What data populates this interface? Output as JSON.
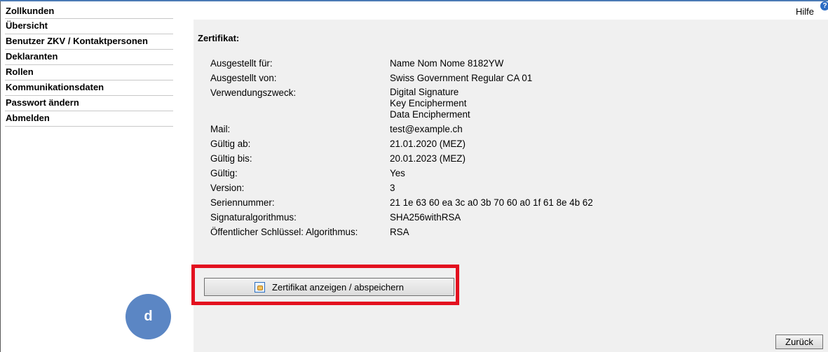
{
  "sidebar": {
    "items": [
      {
        "label": "Zollkunden"
      },
      {
        "label": "Übersicht"
      },
      {
        "label": "Benutzer ZKV / Kontaktpersonen"
      },
      {
        "label": "Deklaranten"
      },
      {
        "label": "Rollen"
      },
      {
        "label": "Kommunikationsdaten"
      },
      {
        "label": "Passwort ändern"
      },
      {
        "label": "Abmelden"
      }
    ]
  },
  "header": {
    "help_label": "Hilfe",
    "help_icon": "question-icon"
  },
  "certificate": {
    "title": "Zertifikat:",
    "rows": [
      {
        "label": "Ausgestellt für:",
        "value": "Name Nom Nome 8182YW"
      },
      {
        "label": "Ausgestellt von:",
        "value": "Swiss Government Regular CA 01"
      },
      {
        "label": "Verwendungszweck:",
        "values": [
          "Digital Signature",
          "Key Encipherment",
          "Data Encipherment"
        ]
      },
      {
        "label": "Mail:",
        "value": "test@example.ch"
      },
      {
        "label": "Gültig ab:",
        "value": "21.01.2020 (MEZ)"
      },
      {
        "label": "Gültig bis:",
        "value": "20.01.2023 (MEZ)"
      },
      {
        "label": "Gültig:",
        "value": "Yes"
      },
      {
        "label": "Version:",
        "value": "3"
      },
      {
        "label": "Seriennummer:",
        "value": "21 1e 63 60 ea 3c a0 3b 70 60 a0 1f 61 8e 4b 62"
      },
      {
        "label": "Signaturalgorithmus:",
        "value": "SHA256withRSA"
      },
      {
        "label": "Öffentlicher Schlüssel: Algorithmus:",
        "value": "RSA"
      }
    ]
  },
  "actions": {
    "show_save_label": "Zertifikat anzeigen / abspeichern",
    "show_save_icon": "certificate-icon",
    "back_label": "Zurück"
  },
  "annotation": {
    "badge_label": "d",
    "highlight_color": "#e3101f",
    "badge_color": "#5b86c4"
  },
  "colors": {
    "panel_background": "#f0f0f0",
    "top_line": "#4a7ab5"
  }
}
